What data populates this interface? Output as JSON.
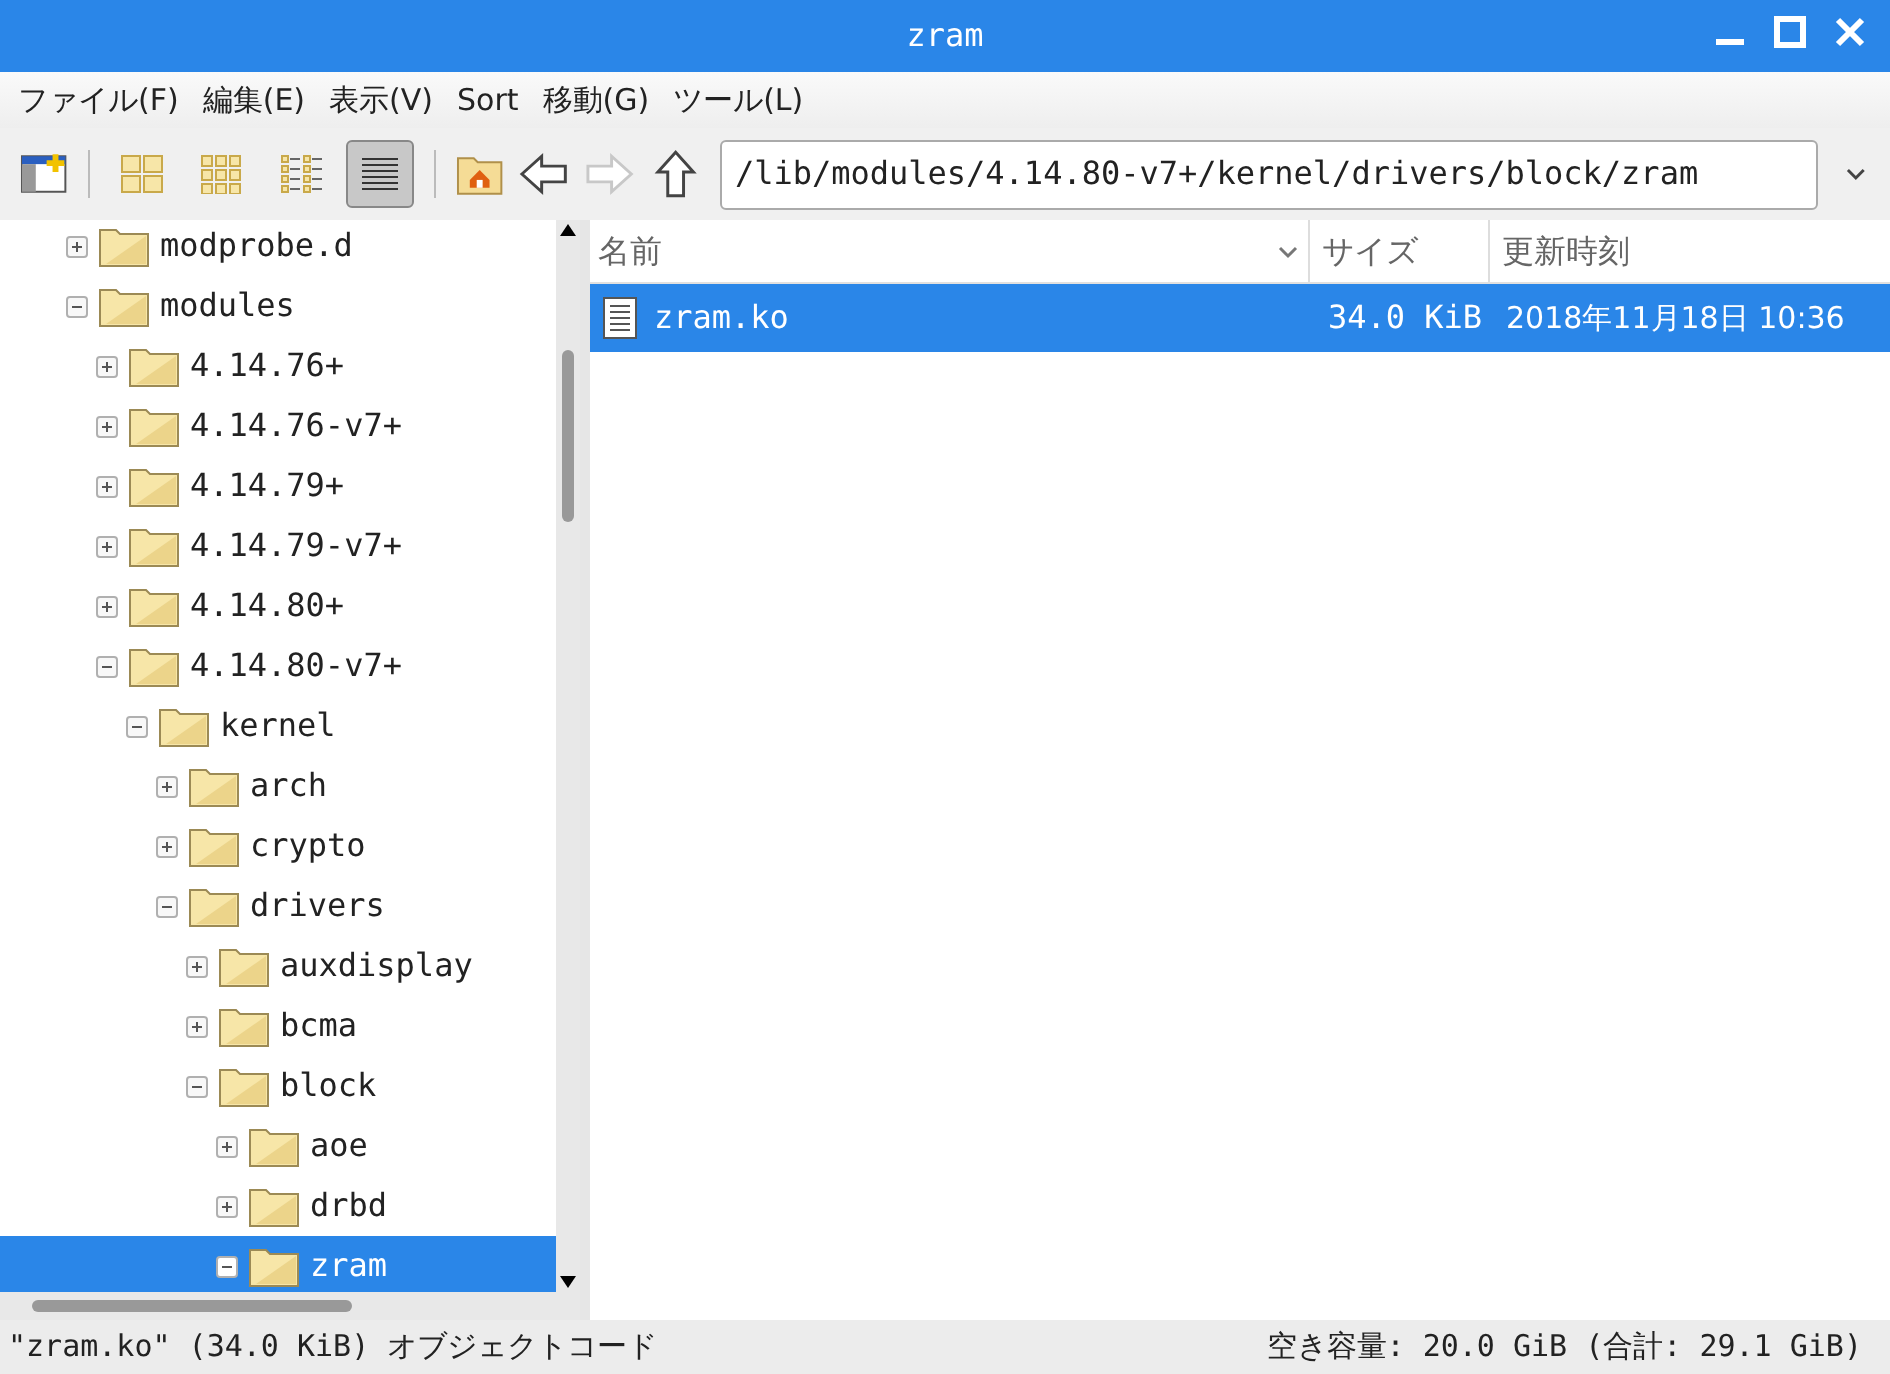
{
  "window": {
    "title": "zram"
  },
  "menu": [
    "ファイル(F)",
    "編集(E)",
    "表示(V)",
    "Sort",
    "移動(G)",
    "ツール(L)"
  ],
  "toolbar": {
    "view_modes": [
      {
        "kind": "icons",
        "selected": false
      },
      {
        "kind": "thumbnails",
        "selected": false
      },
      {
        "kind": "compact",
        "selected": false
      },
      {
        "kind": "list",
        "selected": true
      }
    ],
    "forward_disabled": true
  },
  "location": {
    "value": "/lib/modules/4.14.80-v7+/kernel/drivers/block/zram"
  },
  "tree": [
    {
      "label": "modprobe.d",
      "expanded": false,
      "selected": false
    },
    {
      "label": "modules",
      "expanded": true,
      "selected": false,
      "children": [
        {
          "label": "4.14.76+",
          "expanded": false,
          "selected": false
        },
        {
          "label": "4.14.76-v7+",
          "expanded": false,
          "selected": false
        },
        {
          "label": "4.14.79+",
          "expanded": false,
          "selected": false
        },
        {
          "label": "4.14.79-v7+",
          "expanded": false,
          "selected": false
        },
        {
          "label": "4.14.80+",
          "expanded": false,
          "selected": false
        },
        {
          "label": "4.14.80-v7+",
          "expanded": true,
          "selected": false,
          "children": [
            {
              "label": "kernel",
              "expanded": true,
              "selected": false,
              "children": [
                {
                  "label": "arch",
                  "expanded": false,
                  "selected": false
                },
                {
                  "label": "crypto",
                  "expanded": false,
                  "selected": false
                },
                {
                  "label": "drivers",
                  "expanded": true,
                  "selected": false,
                  "children": [
                    {
                      "label": "auxdisplay",
                      "expanded": false,
                      "selected": false
                    },
                    {
                      "label": "bcma",
                      "expanded": false,
                      "selected": false
                    },
                    {
                      "label": "block",
                      "expanded": true,
                      "selected": false,
                      "children": [
                        {
                          "label": "aoe",
                          "expanded": false,
                          "selected": false
                        },
                        {
                          "label": "drbd",
                          "expanded": false,
                          "selected": false
                        },
                        {
                          "label": "zram",
                          "expanded": true,
                          "selected": true
                        }
                      ]
                    }
                  ]
                }
              ]
            }
          ]
        }
      ]
    }
  ],
  "table": {
    "columns": [
      "名前",
      "サイズ",
      "更新時刻"
    ],
    "rows": [
      {
        "name": "zram.ko",
        "size": "34.0 KiB",
        "modified": "2018年11月18日 10:36",
        "selected": true
      }
    ]
  },
  "status_bar": {
    "left": "\"zram.ko\" (34.0 KiB) オブジェクトコード",
    "right": "空き容量: 20.0 GiB (合計: 29.1 GiB)"
  }
}
